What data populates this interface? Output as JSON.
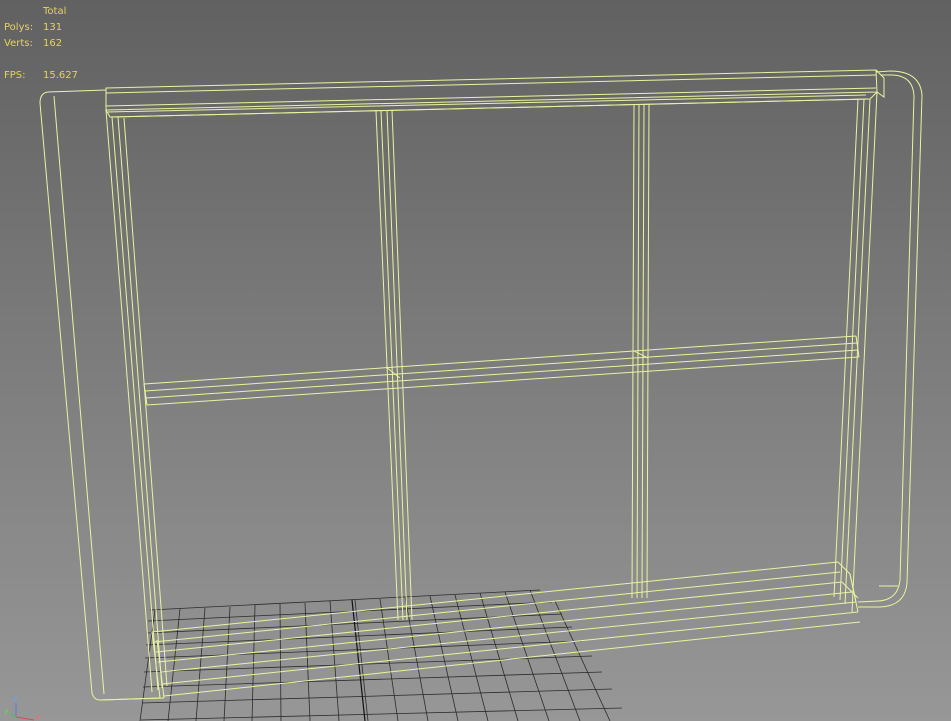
{
  "stats": {
    "header": "Total",
    "polys_label": "Polys:",
    "polys_value": "131",
    "verts_label": "Verts:",
    "verts_value": "162",
    "fps_label": "FPS:",
    "fps_value": "15.627"
  },
  "gizmo": {
    "z_label": "z",
    "y_label": "y",
    "x_label": "x"
  },
  "colors": {
    "wire": "#eaf3a0",
    "grid": "#2b2b2b",
    "stat_text": "#e6d35a"
  }
}
